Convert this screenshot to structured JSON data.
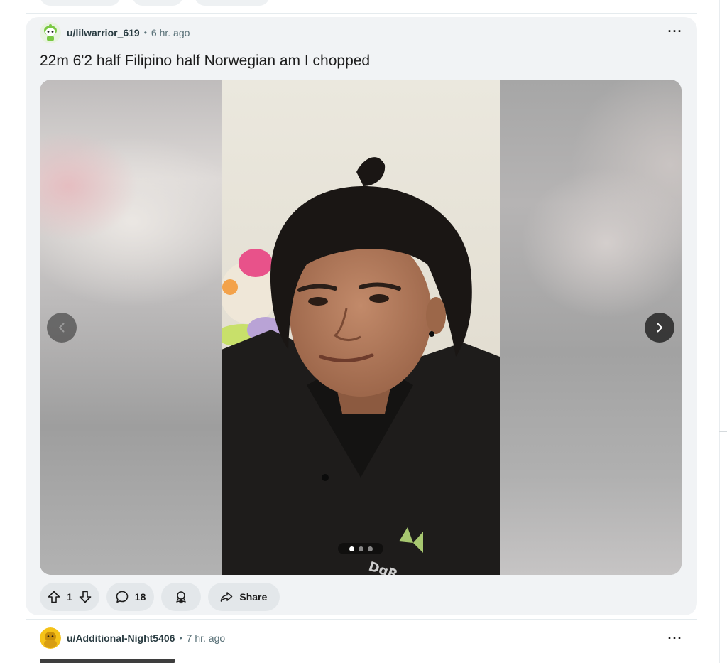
{
  "post": {
    "author": "u/lilwarrior_619",
    "separator": "•",
    "time": "6 hr. ago",
    "more_label": "···",
    "title": "22m 6'2 half Filipino half Norwegian am I chopped",
    "gallery": {
      "current_slide": 1,
      "slide_count": 3,
      "shirt_text": "DqR"
    },
    "votes": "1",
    "comments": "18",
    "share_label": "Share"
  },
  "next_post": {
    "author": "u/Additional-Night5406",
    "separator": "•",
    "time": "7 hr. ago",
    "more_label": "···"
  },
  "icons": {
    "upvote": "upvote-icon",
    "downvote": "downvote-icon",
    "comment": "comment-bubble-icon",
    "award": "award-icon",
    "share": "share-arrow-icon",
    "prev": "chevron-left-icon",
    "next": "chevron-right-icon"
  },
  "colors": {
    "card_bg": "#f1f3f5",
    "pill_bg": "#e3e7ea",
    "meta_text": "#576f76",
    "avatar_green": "#7ac943",
    "avatar_yellow": "#f5c218"
  }
}
